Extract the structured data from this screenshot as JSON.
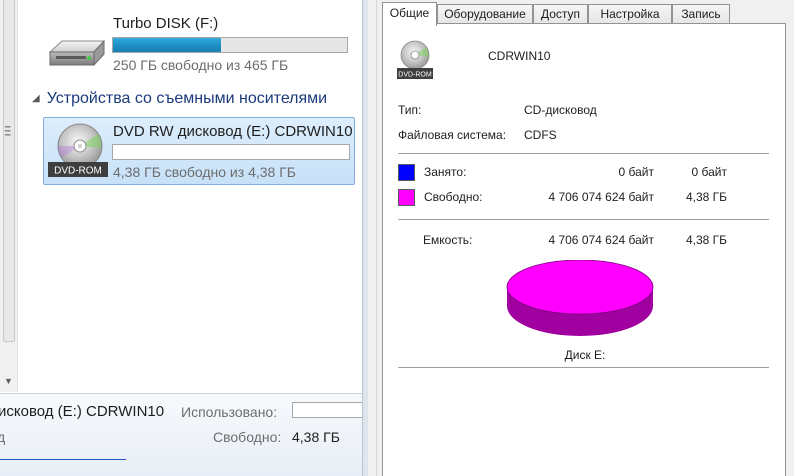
{
  "explorer": {
    "drive_f": {
      "name": "Turbo DISK (F:)",
      "used_fraction": 0.46,
      "free_text": "250 ГБ свободно из 465 ГБ",
      "icon": "hard-drive-icon"
    },
    "section_removable": {
      "title": "Устройства со съемными носителями",
      "icon": "collapse-triangle-icon"
    },
    "drive_e": {
      "name": "DVD RW дисковод (E:) CDRWIN10",
      "used_fraction": 0.0,
      "free_text": "4,38 ГБ свободно из 4,38 ГБ",
      "icon": "dvd-rom-icon",
      "icon_badge": "DVD-ROM"
    },
    "details": {
      "name": "исковод (E:) CDRWIN10",
      "used_label": "Использовано:",
      "type_fragment": "д",
      "free_label": "Свободно:",
      "free_value": "4,38 ГБ"
    }
  },
  "dialog": {
    "tabs": [
      "Общие",
      "Оборудование",
      "Доступ",
      "Настройка",
      "Запись"
    ],
    "active_tab": "Общие",
    "volume_name": "CDRWIN10",
    "icon_badge": "DVD-ROM",
    "type_label": "Тип:",
    "type_value": "CD-дисковод",
    "fs_label": "Файловая система:",
    "fs_value": "CDFS",
    "used": {
      "label": "Занято:",
      "bytes": "0 байт",
      "size": "0 байт",
      "color": "#0000ff"
    },
    "free": {
      "label": "Свободно:",
      "bytes": "4 706 074 624 байт",
      "size": "4,38 ГБ",
      "color": "#ff00ff"
    },
    "capacity": {
      "label": "Емкость:",
      "bytes": "4 706 074 624 байт",
      "size": "4,38 ГБ"
    },
    "disk_label": "Диск E:",
    "pie": {
      "free_fraction": 1.0,
      "free_color": "#ff00ff",
      "free_side_color": "#a000a0",
      "used_color": "#0000ff"
    }
  }
}
